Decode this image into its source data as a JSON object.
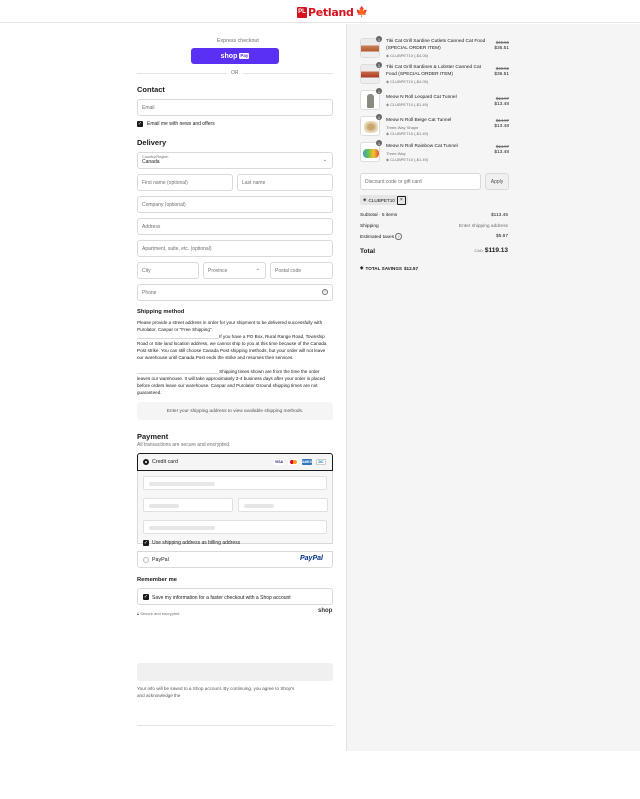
{
  "header": {
    "logo_badge": "PL",
    "logo_text": "Petland",
    "logo_leaf": "🍁"
  },
  "express": {
    "title": "Express checkout",
    "shop_pay_label": "shop",
    "pay_tag": "Pay",
    "or_label": "OR"
  },
  "contact": {
    "title": "Contact",
    "email_placeholder": "Email",
    "news_label": "Email me with news and offers"
  },
  "delivery": {
    "title": "Delivery",
    "country_label": "Country/Region",
    "country_value": "Canada",
    "first_name": "First name (optional)",
    "last_name": "Last name",
    "company": "Company (optional)",
    "address": "Address",
    "apartment": "Apartment, suite, etc. (optional)",
    "city": "City",
    "province": "Province",
    "postal": "Postal code",
    "phone": "Phone"
  },
  "shipping": {
    "title": "Shipping method",
    "p1": "Please provide a street address in order for your shipment to be delivered successfully with Purolator, Canpar or \"Free Shipping\".",
    "p2_line": "____________________________________________________",
    "p2": "If you have a PO Box, Rural Range Road, Township Road or Site land location address, we cannot ship to you at this time because of the Canada Post strike. You can still choose Canada Post shipping methods, but your order will not leave our warehouse until Canada Post ends the strike and resumes their services.",
    "p3_line": "____________________________________________________",
    "p3": "Shipping times shown are from the time the order leaves our warehouse. It will take approximately 2-4 business days after your order is placed before orders leave our warehouse. Canpar and Purolator Ground shipping times are not guaranteed.",
    "notice": "Enter your shipping address to view available shipping methods."
  },
  "payment": {
    "title": "Payment",
    "subtitle": "All transactions are secure and encrypted.",
    "credit_card": "Credit card",
    "brands": [
      "VISA",
      "MC",
      "AMEX",
      "DC"
    ],
    "billing_same": "Use shipping address as billing address",
    "paypal_label": "PayPal",
    "paypal_logo": "PayPal"
  },
  "remember": {
    "title": "Remember me",
    "save_label": "Save my information for a faster checkout with a Shop account",
    "secure_label": "Secure and encrypted",
    "shop_logo": "shop"
  },
  "footer": {
    "pay_button": "",
    "terms": "Your info will be saved to a Shop account. By continuing, you agree to Shop's",
    "terms2": "and acknowledge the"
  },
  "cart": {
    "items": [
      {
        "qty": "1",
        "name": "Tiki Cat Grill Sardine Cutlets Canned Cat Food (SPECIAL ORDER ITEM)",
        "variant": "",
        "discount": "CLUBPET10 (-$4.05)",
        "old": "$40.56",
        "price": "$36.51"
      },
      {
        "qty": "1",
        "name": "Tiki Cat Grill Sardines & Lobster Canned Cat Food (SPECIAL ORDER ITEM)",
        "variant": "",
        "discount": "CLUBPET10 (-$4.05)",
        "old": "$40.56",
        "price": "$36.51"
      },
      {
        "qty": "1",
        "name": "Meow N Roll Leopard Cat Tunnel",
        "variant": "",
        "discount": "CLUBPET10 (-$1.49)",
        "old": "$14.97",
        "price": "$13.48"
      },
      {
        "qty": "1",
        "name": "Meow N Roll Beige Cat Tunnel",
        "variant": "Three-Way Shape",
        "discount": "CLUBPET10 (-$1.49)",
        "old": "$14.97",
        "price": "$13.48"
      },
      {
        "qty": "1",
        "name": "Meow N Roll Rainbow Cat Tunnel",
        "variant": "Three-Way",
        "discount": "CLUBPET10 (-$1.49)",
        "old": "$14.97",
        "price": "$13.48"
      }
    ],
    "discount_placeholder": "Discount code or gift card",
    "apply_label": "Apply",
    "applied_code": "CLUBPET10",
    "subtotal_label": "Subtotal · 5 items",
    "subtotal_value": "$113.46",
    "shipping_label": "Shipping",
    "shipping_value": "Enter shipping address",
    "taxes_label": "Estimated taxes",
    "taxes_value": "$5.67",
    "total_label": "Total",
    "currency": "CAD",
    "total_value": "$119.13",
    "savings_label": "TOTAL SAVINGS",
    "savings_value": "$12.57"
  },
  "colors": {
    "shop_purple": "#5a31f4",
    "brand_red": "#d6121e",
    "paypal_blue": "#003087"
  }
}
